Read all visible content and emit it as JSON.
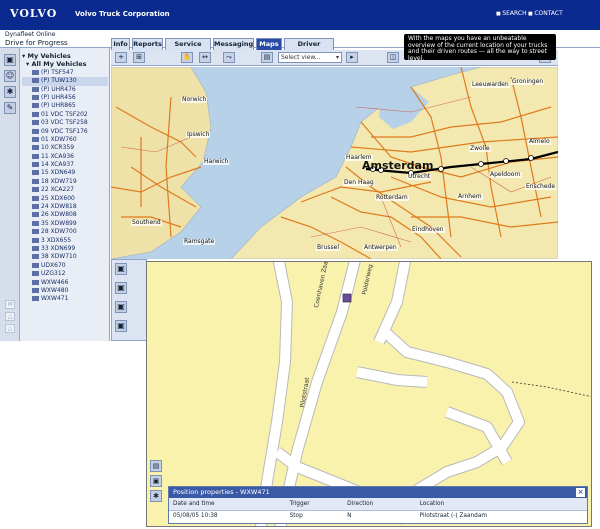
{
  "header": {
    "logo": "VOLVO",
    "company": "Volvo Truck Corporation",
    "links": [
      "SEARCH",
      "CONTACT"
    ]
  },
  "subheader": {
    "app_title": "Dynafleet Online",
    "slogan": "Drive for Progress"
  },
  "tabs": [
    {
      "label": "Info",
      "active": false
    },
    {
      "label": "Reports",
      "active": false
    },
    {
      "label": "Service Plan",
      "active": false
    },
    {
      "label": "Messaging",
      "active": false
    },
    {
      "label": "Maps",
      "active": true
    },
    {
      "label": "Driver Activity",
      "active": false
    }
  ],
  "sidebar": {
    "root_label": "My Vehicles",
    "group_label": "All My Vehicles",
    "vehicles": [
      "(P) TSF547",
      "(P) TUW130",
      "(P) UHR476",
      "(P) UHR456",
      "(P) UHR865",
      "01 VDC TSF202",
      "03 VDC TSF258",
      "09 VDC TSF176",
      "01 XDW760",
      "10 XCR359",
      "11 XCA936",
      "14 XCA937",
      "15 XDN649",
      "18 XDW719",
      "22 XCA227",
      "25 XDX600",
      "24 XDW818",
      "26 XDW808",
      "35 XDW899",
      "28 XDW700",
      "3 XDX655",
      "33 XDN699",
      "38 XDW710",
      "UDX670",
      "UZG312",
      "WXW466",
      "WXW480",
      "WXW471"
    ],
    "selected_index": 1
  },
  "mapbar": {
    "select_view_label": "Select view..."
  },
  "tooltip": {
    "text": "With the maps you have an unbeatable overview of the current location of your trucks and their driven routes — all the way to street level."
  },
  "map": {
    "city_labels": [
      "Amsterdam",
      "Zwolle",
      "Enschede",
      "Arnhem",
      "Rotterdam",
      "Harwich",
      "Ipswich",
      "Norwich",
      "Southend",
      "Ramsgate",
      "Antwerpen",
      "Brussel",
      "Utrecht",
      "Den Haag",
      "Haarlem",
      "Leeuwarden",
      "Groningen",
      "Almelo",
      "Apeldoorn",
      "Eindhoven"
    ]
  },
  "zoom_map": {
    "street_labels": [
      "Coenhaven Zaanstraat",
      "Polderweg",
      "Pilotstraat",
      "Basisweg"
    ]
  },
  "position_panel": {
    "title": "Position properties - WXW471",
    "columns": [
      "Date and time",
      "Trigger",
      "Direction",
      "Location"
    ],
    "rows": [
      [
        "05/08/05 10:38",
        "Stop",
        "N",
        "Pilotstraat (-) Zaandam"
      ]
    ]
  },
  "colors": {
    "header_bg": "#0a2a8f",
    "tab_active": "#2a4aa8",
    "zoom_land": "#f8f2ad",
    "sea": "#b7d2e8",
    "land": "#f3e9b0",
    "roads": "#e07a1e"
  },
  "icons": {
    "sidebar_tools": [
      "vehicles-icon",
      "people-icon",
      "settings-icon",
      "wrench-icon"
    ]
  }
}
